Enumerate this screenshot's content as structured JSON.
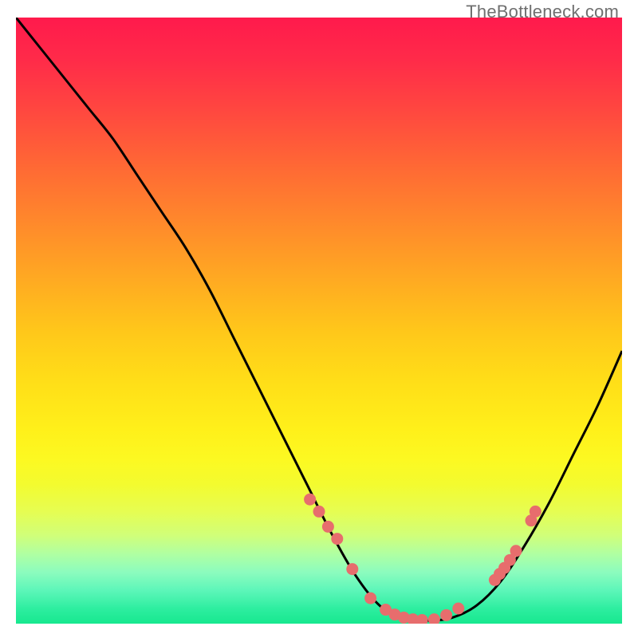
{
  "watermark": "TheBottleneck.com",
  "chart_data": {
    "type": "line",
    "title": "",
    "xlabel": "",
    "ylabel": "",
    "xlim": [
      0,
      100
    ],
    "ylim": [
      0,
      100
    ],
    "series": [
      {
        "name": "curve",
        "x": [
          0,
          4,
          8,
          12,
          16,
          20,
          24,
          28,
          32,
          36,
          40,
          44,
          48,
          52,
          56,
          60,
          64,
          68,
          72,
          76,
          80,
          84,
          88,
          92,
          96,
          100
        ],
        "y": [
          100,
          95,
          90,
          85,
          80,
          74,
          68,
          62,
          55,
          47,
          39,
          31,
          23,
          15,
          8,
          3,
          1,
          0.5,
          1,
          3,
          7,
          13,
          20,
          28,
          36,
          45
        ]
      }
    ],
    "points": {
      "name": "markers",
      "x": [
        48.5,
        50,
        51.5,
        53,
        55.5,
        58.5,
        61,
        62.5,
        64,
        65.5,
        67,
        69,
        71,
        73,
        79,
        79.8,
        80.6,
        81.5,
        82.5,
        85,
        85.7
      ],
      "y": [
        20.5,
        18.5,
        16.0,
        14.0,
        9.0,
        4.2,
        2.3,
        1.5,
        1.0,
        0.7,
        0.6,
        0.7,
        1.4,
        2.5,
        7.2,
        8.2,
        9.2,
        10.5,
        12.0,
        17.0,
        18.5
      ]
    },
    "gradient_stops": [
      {
        "offset": 0.0,
        "color": "#ff1a4c"
      },
      {
        "offset": 0.07,
        "color": "#ff2b49"
      },
      {
        "offset": 0.15,
        "color": "#ff4640"
      },
      {
        "offset": 0.25,
        "color": "#ff6a34"
      },
      {
        "offset": 0.35,
        "color": "#ff8d2a"
      },
      {
        "offset": 0.45,
        "color": "#ffb020"
      },
      {
        "offset": 0.52,
        "color": "#ffc81a"
      },
      {
        "offset": 0.6,
        "color": "#ffde18"
      },
      {
        "offset": 0.68,
        "color": "#fff01a"
      },
      {
        "offset": 0.73,
        "color": "#fcf922"
      },
      {
        "offset": 0.77,
        "color": "#f3fb2f"
      },
      {
        "offset": 0.815,
        "color": "#e6fd52"
      },
      {
        "offset": 0.855,
        "color": "#d0ff7a"
      },
      {
        "offset": 0.885,
        "color": "#b0ffa2"
      },
      {
        "offset": 0.915,
        "color": "#8cfcbe"
      },
      {
        "offset": 0.945,
        "color": "#5df6b9"
      },
      {
        "offset": 0.975,
        "color": "#2eeea0"
      },
      {
        "offset": 1.0,
        "color": "#17e88f"
      }
    ],
    "marker_color": "#e76d6d",
    "curve_color": "#000000"
  }
}
